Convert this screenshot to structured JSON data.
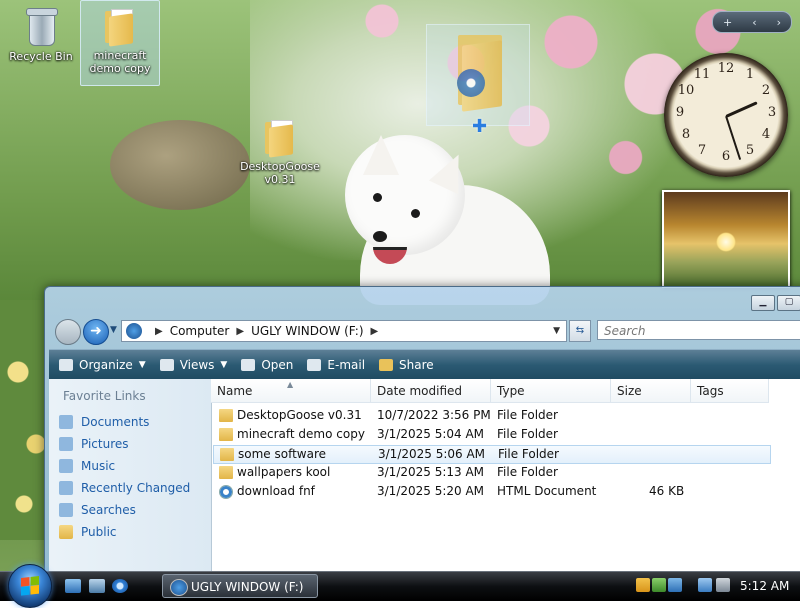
{
  "desktop": {
    "icons": [
      {
        "label": "Recycle Bin"
      },
      {
        "label": "minecraft demo copy"
      },
      {
        "label": "DesktopGoose v0.31"
      }
    ]
  },
  "gadgets": {
    "controls": [
      "+",
      "‹",
      "›"
    ],
    "clock_numbers": [
      "12",
      "1",
      "2",
      "3",
      "4",
      "5",
      "6",
      "7",
      "8",
      "9",
      "10",
      "11"
    ]
  },
  "explorer": {
    "address": {
      "root": "Computer",
      "drive": "UGLY WINDOW (F:)"
    },
    "search_placeholder": "Search",
    "toolbar": {
      "organize": "Organize",
      "views": "Views",
      "open": "Open",
      "email": "E-mail",
      "share": "Share"
    },
    "nav_pane": {
      "heading": "Favorite Links",
      "links": [
        "Documents",
        "Pictures",
        "Music",
        "Recently Changed",
        "Searches",
        "Public"
      ]
    },
    "columns": [
      "Name",
      "Date modified",
      "Type",
      "Size",
      "Tags"
    ],
    "rows": [
      {
        "name": "DesktopGoose v0.31",
        "date": "10/7/2022 3:56 PM",
        "type": "File Folder",
        "size": ""
      },
      {
        "name": "minecraft demo copy",
        "date": "3/1/2025 5:04 AM",
        "type": "File Folder",
        "size": ""
      },
      {
        "name": "some software",
        "date": "3/1/2025 5:06 AM",
        "type": "File Folder",
        "size": ""
      },
      {
        "name": "wallpapers kool",
        "date": "3/1/2025 5:13 AM",
        "type": "File Folder",
        "size": ""
      },
      {
        "name": "download fnf",
        "date": "3/1/2025 5:20 AM",
        "type": "HTML Document",
        "size": "46 KB"
      }
    ],
    "selected_row": 2
  },
  "taskbar": {
    "task_button": "UGLY WINDOW (F:)",
    "time": "5:12 AM"
  }
}
